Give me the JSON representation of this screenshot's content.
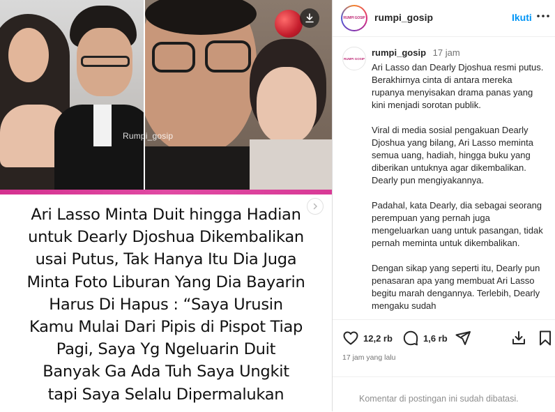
{
  "media": {
    "watermark": "Rumpi_gosip",
    "headline": [
      "Ari Lasso Minta Duit hingga Hadian",
      "untuk Dearly Djoshua Dikembalikan",
      "usai Putus, Tak Hanya Itu Dia Juga",
      "Minta Foto Liburan Yang Dia Bayarin",
      "Harus Di Hapus : “Saya Urusin",
      "Kamu Mulai Dari Pipis di Pispot Tiap",
      "Pagi, Saya Yg Ngeluarin Duit",
      "Banyak Ga Ada Tuh Saya Ungkit",
      "tapi Saya Selalu Dipermalukan"
    ],
    "download_icon": "download-icon",
    "next_icon": "chevron-right-icon"
  },
  "header": {
    "username": "rumpi_gosip",
    "follow_label": "Ikuti",
    "more_icon": "more-icon",
    "avatar_text": "RUMPI GOSIP"
  },
  "caption": {
    "username": "rumpi_gosip",
    "time": "17 jam",
    "avatar_text": "RUMPI GOSIP",
    "text": "Ari Lasso dan Dearly Djoshua resmi putus. Berakhirnya cinta di antara mereka rupanya menyisakan drama panas yang kini menjadi sorotan publik.\n\nViral di media sosial pengakuan Dearly Djoshua yang bilang, Ari Lasso meminta semua uang, hadiah, hingga buku yang diberikan untuknya  agar dikembalikan. Dearly pun mengiyakannya.\n\nPadahal, kata Dearly, dia sebagai seorang perempuan yang pernah juga mengeluarkan uang untuk pasangan, tidak pernah meminta untuk dikembalikan.\n\nDengan sikap yang seperti itu, Dearly pun penasaran apa yang membuat Ari Lasso begitu marah dengannya. Terlebih, Dearly mengaku sudah"
  },
  "actions": {
    "like_count": "12,2 rb",
    "comment_count": "1,6 rb",
    "posted": "17 jam yang lalu",
    "icons": [
      "heart-icon",
      "comment-icon",
      "share-icon",
      "download-icon",
      "bookmark-icon"
    ]
  },
  "comments": {
    "limited_text": "Komentar di postingan ini sudah dibatasi."
  }
}
